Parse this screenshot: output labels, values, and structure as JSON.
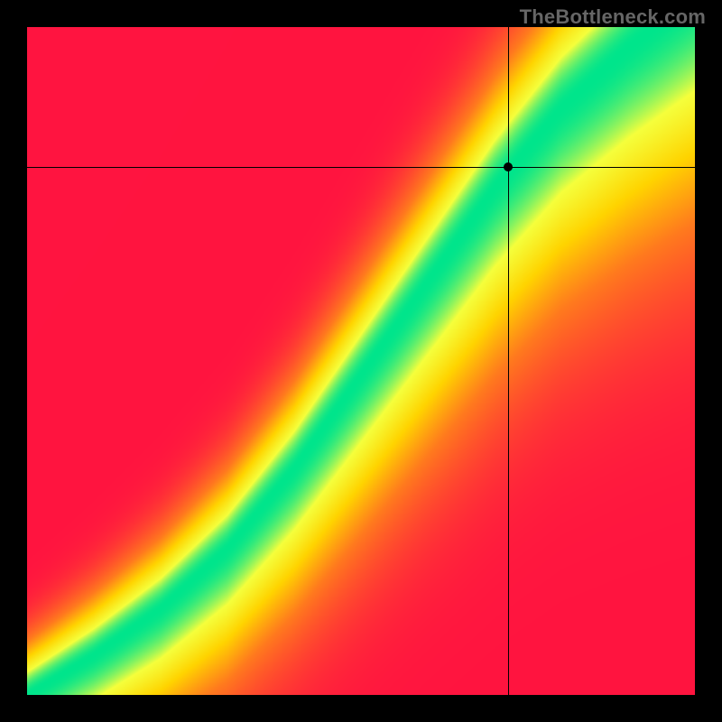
{
  "watermark": "TheBottleneck.com",
  "chart_data": {
    "type": "heatmap",
    "title": "",
    "xlabel": "",
    "ylabel": "",
    "xlim": [
      0,
      1
    ],
    "ylim": [
      0,
      1
    ],
    "grid": false,
    "legend": false,
    "colormap_stops": [
      {
        "t": 0.0,
        "color": "#ff1440"
      },
      {
        "t": 0.4,
        "color": "#ff7a1e"
      },
      {
        "t": 0.65,
        "color": "#ffd400"
      },
      {
        "t": 0.85,
        "color": "#f5ff3c"
      },
      {
        "t": 1.0,
        "color": "#00e58c"
      }
    ],
    "ridge": {
      "description": "green optimal band along a curved diagonal",
      "points": [
        {
          "x": 0.0,
          "y": 0.0
        },
        {
          "x": 0.1,
          "y": 0.06
        },
        {
          "x": 0.2,
          "y": 0.13
        },
        {
          "x": 0.3,
          "y": 0.22
        },
        {
          "x": 0.4,
          "y": 0.34
        },
        {
          "x": 0.5,
          "y": 0.48
        },
        {
          "x": 0.6,
          "y": 0.62
        },
        {
          "x": 0.7,
          "y": 0.76
        },
        {
          "x": 0.8,
          "y": 0.88
        },
        {
          "x": 0.9,
          "y": 0.97
        },
        {
          "x": 1.0,
          "y": 1.05
        }
      ],
      "half_width": 0.05
    },
    "crosshair": {
      "x": 0.72,
      "y": 0.79
    },
    "marker": {
      "x": 0.72,
      "y": 0.79
    }
  }
}
